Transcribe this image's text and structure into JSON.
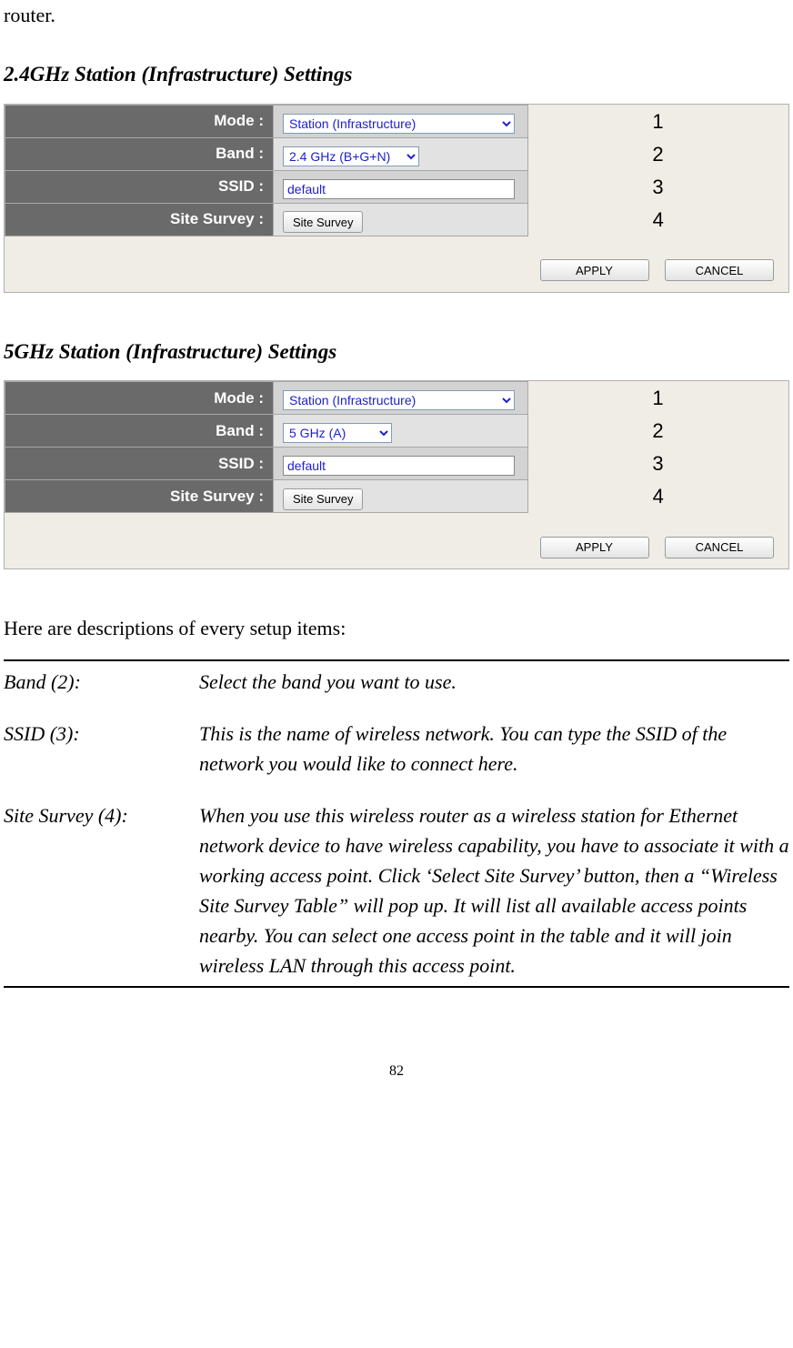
{
  "intro_text": "router.",
  "sections": {
    "s1": {
      "heading": "2.4GHz Station (Infrastructure) Settings",
      "rows": {
        "mode": {
          "label": "Mode :",
          "value": "Station (Infrastructure)",
          "annotation": "1"
        },
        "band": {
          "label": "Band :",
          "value": "2.4 GHz (B+G+N)",
          "annotation": "2"
        },
        "ssid": {
          "label": "SSID :",
          "value": "default",
          "annotation": "3"
        },
        "survey": {
          "label": "Site Survey :",
          "button": "Site Survey",
          "annotation": "4"
        }
      },
      "footer": {
        "apply": "APPLY",
        "cancel": "CANCEL"
      }
    },
    "s2": {
      "heading": "5GHz Station (Infrastructure) Settings",
      "rows": {
        "mode": {
          "label": "Mode :",
          "value": "Station (Infrastructure)",
          "annotation": "1"
        },
        "band": {
          "label": "Band :",
          "value": "5 GHz (A)",
          "annotation": "2"
        },
        "ssid": {
          "label": "SSID :",
          "value": "default",
          "annotation": "3"
        },
        "survey": {
          "label": "Site Survey :",
          "button": "Site Survey",
          "annotation": "4"
        }
      },
      "footer": {
        "apply": "APPLY",
        "cancel": "CANCEL"
      }
    }
  },
  "descriptions_intro": "Here are descriptions of every setup items:",
  "descriptions": {
    "band": {
      "label": "Band (2):",
      "text": "Select the band you want to use."
    },
    "ssid": {
      "label": "SSID (3):",
      "text": "This is the name of wireless network. You can type the SSID of the network you would like to connect here."
    },
    "survey": {
      "label": "Site Survey (4):",
      "text": "When you use this wireless router as a wireless station for Ethernet network device to have wireless capability, you have to associate it with a working access point. Click ‘Select Site Survey’ button, then a “Wireless Site Survey Table” will pop up. It will list all available access points nearby. You can select one access point in the table and it will join wireless LAN through this access point."
    }
  },
  "page_number": "82"
}
